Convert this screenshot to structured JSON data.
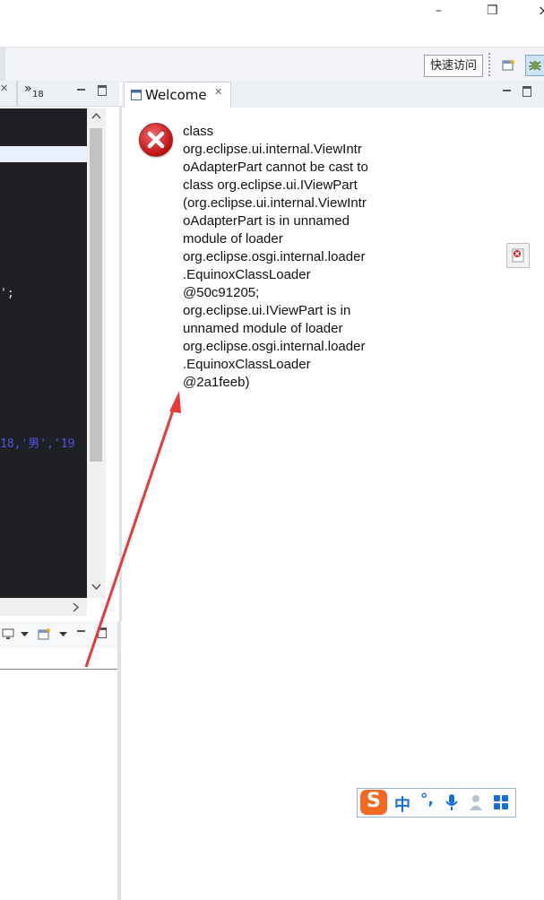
{
  "window": {
    "minimize_glyph": "–",
    "restore_glyph": "❐",
    "close_glyph": "×"
  },
  "toolbar": {
    "quick_access_label": "快速访问"
  },
  "left_tabs": {
    "close_glyph": "✕",
    "overflow_label": "»",
    "overflow_count": "18"
  },
  "editor": {
    "code_line_1": "';",
    "code_line_2": "18,'男','19"
  },
  "welcome": {
    "tab_title": "Welcome",
    "close_glyph": "✕",
    "error_message": "class\norg.eclipse.ui.internal.ViewIntr\noAdapterPart cannot be cast to\nclass org.eclipse.ui.IViewPart\n(org.eclipse.ui.internal.ViewIntr\noAdapterPart is in unnamed\nmodule of loader\norg.eclipse.osgi.internal.loader\n.EquinoxClassLoader\n@50c91205;\norg.eclipse.ui.IViewPart is in\nunnamed module of loader\norg.eclipse.osgi.internal.loader\n.EquinoxClassLoader\n@2a1feeb)"
  },
  "ime": {
    "logo_letter": "S",
    "mode_label": "中",
    "punct_label": "°,"
  },
  "colors": {
    "error_red": "#c01010",
    "arrow_red": "#e83a3a",
    "ime_blue": "#1a6fd6",
    "ime_orange": "#f26a21"
  }
}
